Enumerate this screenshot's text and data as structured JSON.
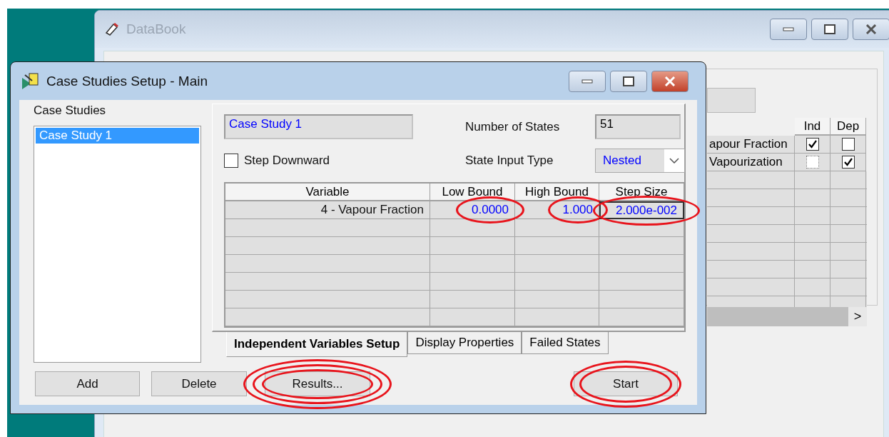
{
  "background_window": {
    "title": "DataBook",
    "grid": {
      "columns": [
        "Ind",
        "Dep"
      ],
      "rows": [
        {
          "name": "apour Fraction",
          "ind": {
            "checked": true,
            "focused": false
          },
          "dep": {
            "checked": false,
            "focused": false
          }
        },
        {
          "name": "Vapourization",
          "ind": {
            "checked": false,
            "focused": true
          },
          "dep": {
            "checked": true,
            "focused": false
          }
        }
      ],
      "scroll_arrow": ">"
    }
  },
  "dialog": {
    "title": "Case Studies Setup - Main",
    "case_studies": {
      "label": "Case Studies",
      "items": [
        {
          "label": "Case Study 1",
          "selected": true
        }
      ]
    },
    "name_field": {
      "value": "Case Study 1"
    },
    "number_of_states": {
      "label": "Number of States",
      "value": "51"
    },
    "step_downward": {
      "label": "Step Downward",
      "checked": false
    },
    "state_input_type": {
      "label": "State Input Type",
      "value": "Nested"
    },
    "variables_table": {
      "columns": [
        "Variable",
        "Low Bound",
        "High Bound",
        "Step Size"
      ],
      "rows": [
        {
          "cells": [
            {
              "text": "4 - Vapour Fraction",
              "circled": false
            },
            {
              "text": "0.0000",
              "circled": true
            },
            {
              "text": "1.000",
              "circled": true
            },
            {
              "text": "2.000e-002",
              "circled": true
            }
          ]
        }
      ]
    },
    "tabs": [
      {
        "label": "Independent Variables Setup",
        "selected": true
      },
      {
        "label": "Display Properties",
        "selected": false
      },
      {
        "label": "Failed States",
        "selected": false
      }
    ],
    "buttons": [
      {
        "label": "Add",
        "circled": false
      },
      {
        "label": "Delete",
        "circled": false
      },
      {
        "label": "Results...",
        "circled": true
      },
      {
        "label": "Start",
        "circled": true
      }
    ]
  }
}
